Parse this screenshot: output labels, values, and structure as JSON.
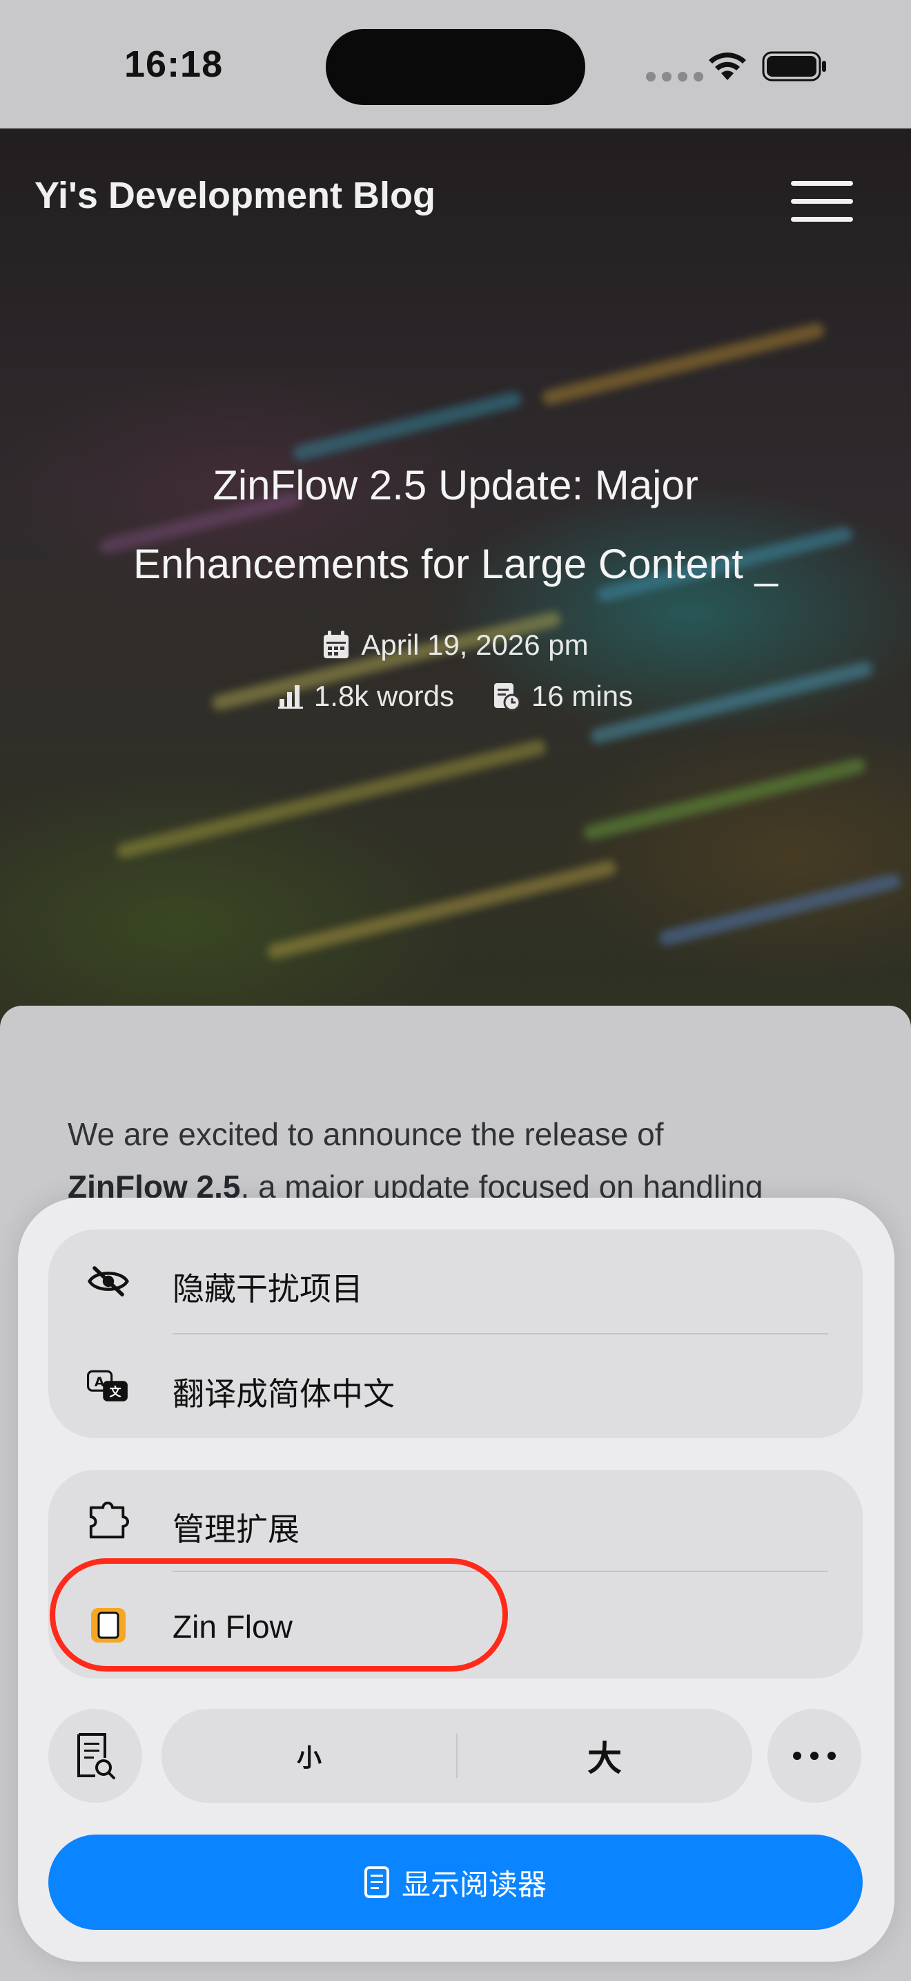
{
  "status_bar": {
    "time": "16:18"
  },
  "site": {
    "title": "Yi's Development Blog"
  },
  "post": {
    "title_line1": "ZinFlow 2.5 Update: Major",
    "title_line2": "Enhancements for Large Content _",
    "date": "April 19, 2026 pm",
    "words": "1.8k words",
    "read_time": "16 mins"
  },
  "article": {
    "intro_start": "We are excited to announce the release of",
    "intro_bold": "ZinFlow 2.5",
    "intro_end": ", a major update focused on handling"
  },
  "sheet": {
    "hide_distractions": "隐藏干扰项目",
    "translate": "翻译成简体中文",
    "manage_extensions": "管理扩展",
    "zinflow": "Zin Flow",
    "text_smaller": "小",
    "text_larger": "大",
    "show_reader": "显示阅读器"
  },
  "colors": {
    "accent_blue": "#0a84ff",
    "highlight_red": "#ff2a1a",
    "zinflow_orange": "#f5a623"
  },
  "icons": {
    "hide": "eye-slash-icon",
    "translate": "translate-icon",
    "extensions": "puzzle-icon",
    "zinflow": "zinflow-icon",
    "reader_search": "doc-search-icon",
    "more": "ellipsis-icon",
    "reader": "reader-doc-icon"
  }
}
